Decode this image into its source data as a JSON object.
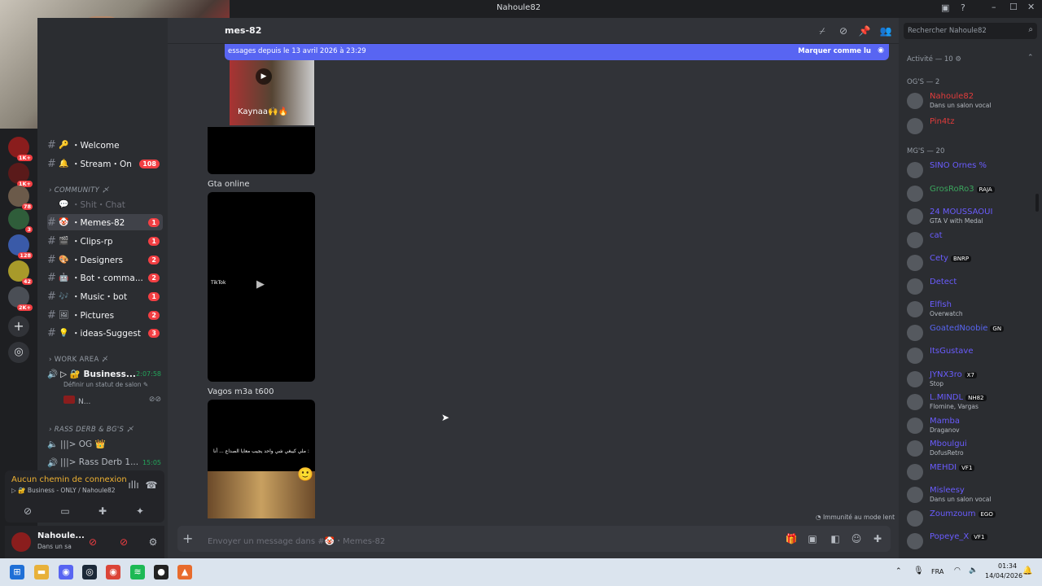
{
  "window": {
    "title": "Nahoule82"
  },
  "channel_header": {
    "name": "mes-82",
    "search_placeholder": "Rechercher Nahoule82"
  },
  "new_messages_bar": {
    "text": "essages depuis le 13 avril 2026 à 23:29",
    "action": "Marquer comme lu"
  },
  "servers": [
    {
      "badge": "1K+"
    },
    {
      "badge": "1K+"
    },
    {
      "badge": "78"
    },
    {
      "badge": "3"
    },
    {
      "badge": "128"
    },
    {
      "badge": "42"
    },
    {
      "badge": "2K+"
    }
  ],
  "channels": {
    "top": [
      {
        "emoji": "🔑",
        "label": "・Welcome",
        "badge": ""
      },
      {
        "emoji": "🔔",
        "label": "・Stream・On",
        "badge": "108"
      }
    ],
    "community_category": "COMMUNITY 〆",
    "community": [
      {
        "emoji": "💬",
        "label": "・Shit・Chat",
        "badge": "",
        "muted": true
      },
      {
        "emoji": "🤡",
        "label": "・Memes-82",
        "badge": "1",
        "active": true
      },
      {
        "emoji": "🎬",
        "label": "・Clips-rp",
        "badge": "1"
      },
      {
        "emoji": "🎨",
        "label": "・Designers",
        "badge": "2"
      },
      {
        "emoji": "🤖",
        "label": "・Bot・comma...",
        "badge": "2"
      },
      {
        "emoji": "🎶",
        "label": "・Music・bot",
        "badge": "1"
      },
      {
        "emoji": "🖼",
        "label": "・Pictures",
        "badge": "2"
      },
      {
        "emoji": "💡",
        "label": "・ideas-Suggest",
        "badge": "3"
      }
    ],
    "work_category": "WORK AREA 〆",
    "voice_business": {
      "label": "▷ 🔐 Business...",
      "time": "2:07:58",
      "status": "Définir un statut de salon ✎",
      "user": "N..."
    },
    "rass_category": "RASS DERB & BG'S 〆",
    "voice_og": {
      "label": "|||> OG 👑"
    },
    "voice_rass": {
      "label": "|||> Rass Derb 1...",
      "time": "15:05"
    }
  },
  "voice_panel": {
    "status": "Aucun chemin de connexion",
    "sub": "▷ 🔐 Business - ONLY / Nahoule82"
  },
  "user_panel": {
    "name": "Nahoule...",
    "status": "Dans un sa"
  },
  "messages": [
    {
      "title": "",
      "video_caption": "Kaynaa🙌🔥"
    },
    {
      "title": "Gta online",
      "video_caption": "TikTok"
    },
    {
      "title": "Vagos m3a t600",
      "video_caption": "ملي كيبغي شي واحد يجيب معايا الصداع ... أنا :"
    }
  ],
  "slow_mode": "Immunité au mode lent",
  "composer": {
    "placeholder": "Envoyer un message dans #🤡・Memes-82"
  },
  "members": {
    "activity_header": "Activité — 10 ⚙",
    "groups": [
      {
        "label": "OG'S — 2",
        "members": [
          {
            "name": "Nahoule82",
            "status": "Dans un salon vocal",
            "color": "#e23c3c"
          },
          {
            "name": "Pin4tz",
            "status": "",
            "color": "#e23c3c"
          }
        ]
      },
      {
        "label": "MG'S — 20",
        "members": [
          {
            "name": "SINO Ornes %",
            "status": "",
            "color": "#6a5cff"
          },
          {
            "name": "GrosRoRo3",
            "status": "",
            "tag": "RAJA",
            "color": "#3ba55d"
          },
          {
            "name": "24 MOUSSAOUI",
            "status": "GTA V with Medal",
            "color": "#6a5cff"
          },
          {
            "name": "cat",
            "status": "",
            "color": "#6a5cff"
          },
          {
            "name": "Cety",
            "status": "",
            "tag": "BNRP",
            "color": "#6a5cff"
          },
          {
            "name": "Detect",
            "status": "",
            "color": "#6a5cff"
          },
          {
            "name": "Elfish",
            "status": "Overwatch",
            "color": "#6a5cff"
          },
          {
            "name": "GoatedNoobie",
            "status": "",
            "tag": "GN",
            "color": "#5865f2"
          },
          {
            "name": "ItsGustave",
            "status": "",
            "color": "#6a5cff"
          },
          {
            "name": "JYNX3ro",
            "status": "Stop",
            "tag": "X7",
            "color": "#6a5cff"
          },
          {
            "name": "L.MINDL",
            "status": "Flomine, Vargas",
            "tag": "NH82",
            "color": "#6a5cff"
          },
          {
            "name": "Mamba",
            "status": "Draganov",
            "color": "#6a5cff"
          },
          {
            "name": "Mboulgui",
            "status": "DofusRetro",
            "color": "#6a5cff"
          },
          {
            "name": "MEHDI",
            "status": "",
            "tag": "VF1",
            "color": "#6a5cff"
          },
          {
            "name": "Misleesy",
            "status": "Dans un salon vocal",
            "color": "#6a5cff"
          },
          {
            "name": "Zoumzoum",
            "status": "",
            "tag": "EGO",
            "color": "#6a5cff"
          },
          {
            "name": "Popeye_X",
            "status": "",
            "tag": "VF1",
            "color": "#6a5cff"
          }
        ]
      }
    ]
  },
  "taskbar": {
    "lang": "FRA",
    "time": "01:34",
    "date": "14/04/2026"
  },
  "colors": {
    "accent": "#5865f2",
    "badge": "#f23f43",
    "online": "#23a55a"
  }
}
